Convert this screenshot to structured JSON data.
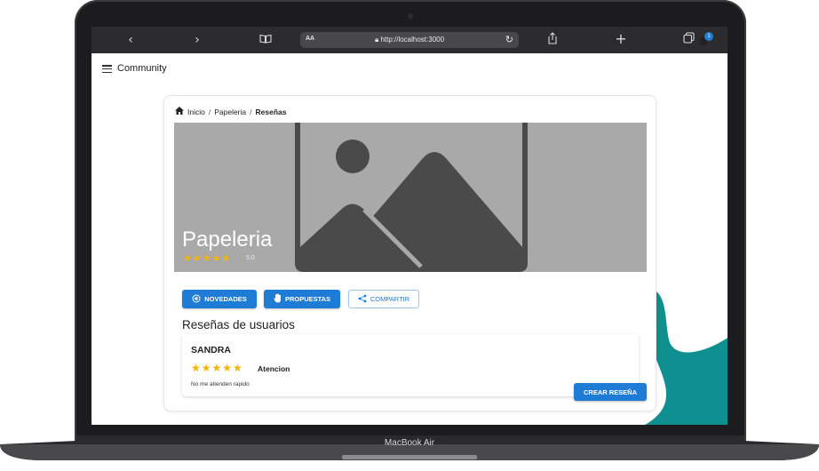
{
  "device": {
    "label": "MacBook Air"
  },
  "browser": {
    "aa_label": "AA",
    "url": "http://localhost:3000",
    "icons": [
      "chevron-left-icon",
      "chevron-right-icon",
      "book-icon",
      "reload-icon",
      "share-icon",
      "plus-icon",
      "tabs-icon",
      "lock-icon"
    ]
  },
  "app": {
    "title": "Community",
    "notification_count": "1"
  },
  "breadcrumb": {
    "home": "Inicio",
    "sep1": "/",
    "category": "Papeleria",
    "sep2": "/",
    "current": "Reseñas"
  },
  "hero": {
    "title": "Papeleria",
    "stars": "★★★★★",
    "rating": "5.0"
  },
  "actions": {
    "novedades": "NOVEDADES",
    "propuestas": "PROPUESTAS",
    "compartir": "COMPARTIR"
  },
  "reviews_section": {
    "title": "Reseñas de usuarios",
    "items": [
      {
        "name": "SANDRA",
        "stars": "★★★★★",
        "tag": "Atencion",
        "text": "No me atienden rapido"
      }
    ],
    "create_label": "CREAR RESEÑA"
  },
  "colors": {
    "primary": "#1e7bd6",
    "star": "#f5b400",
    "accent_teal": "#0f8f8f",
    "hero_bg": "#a9a9a9"
  }
}
